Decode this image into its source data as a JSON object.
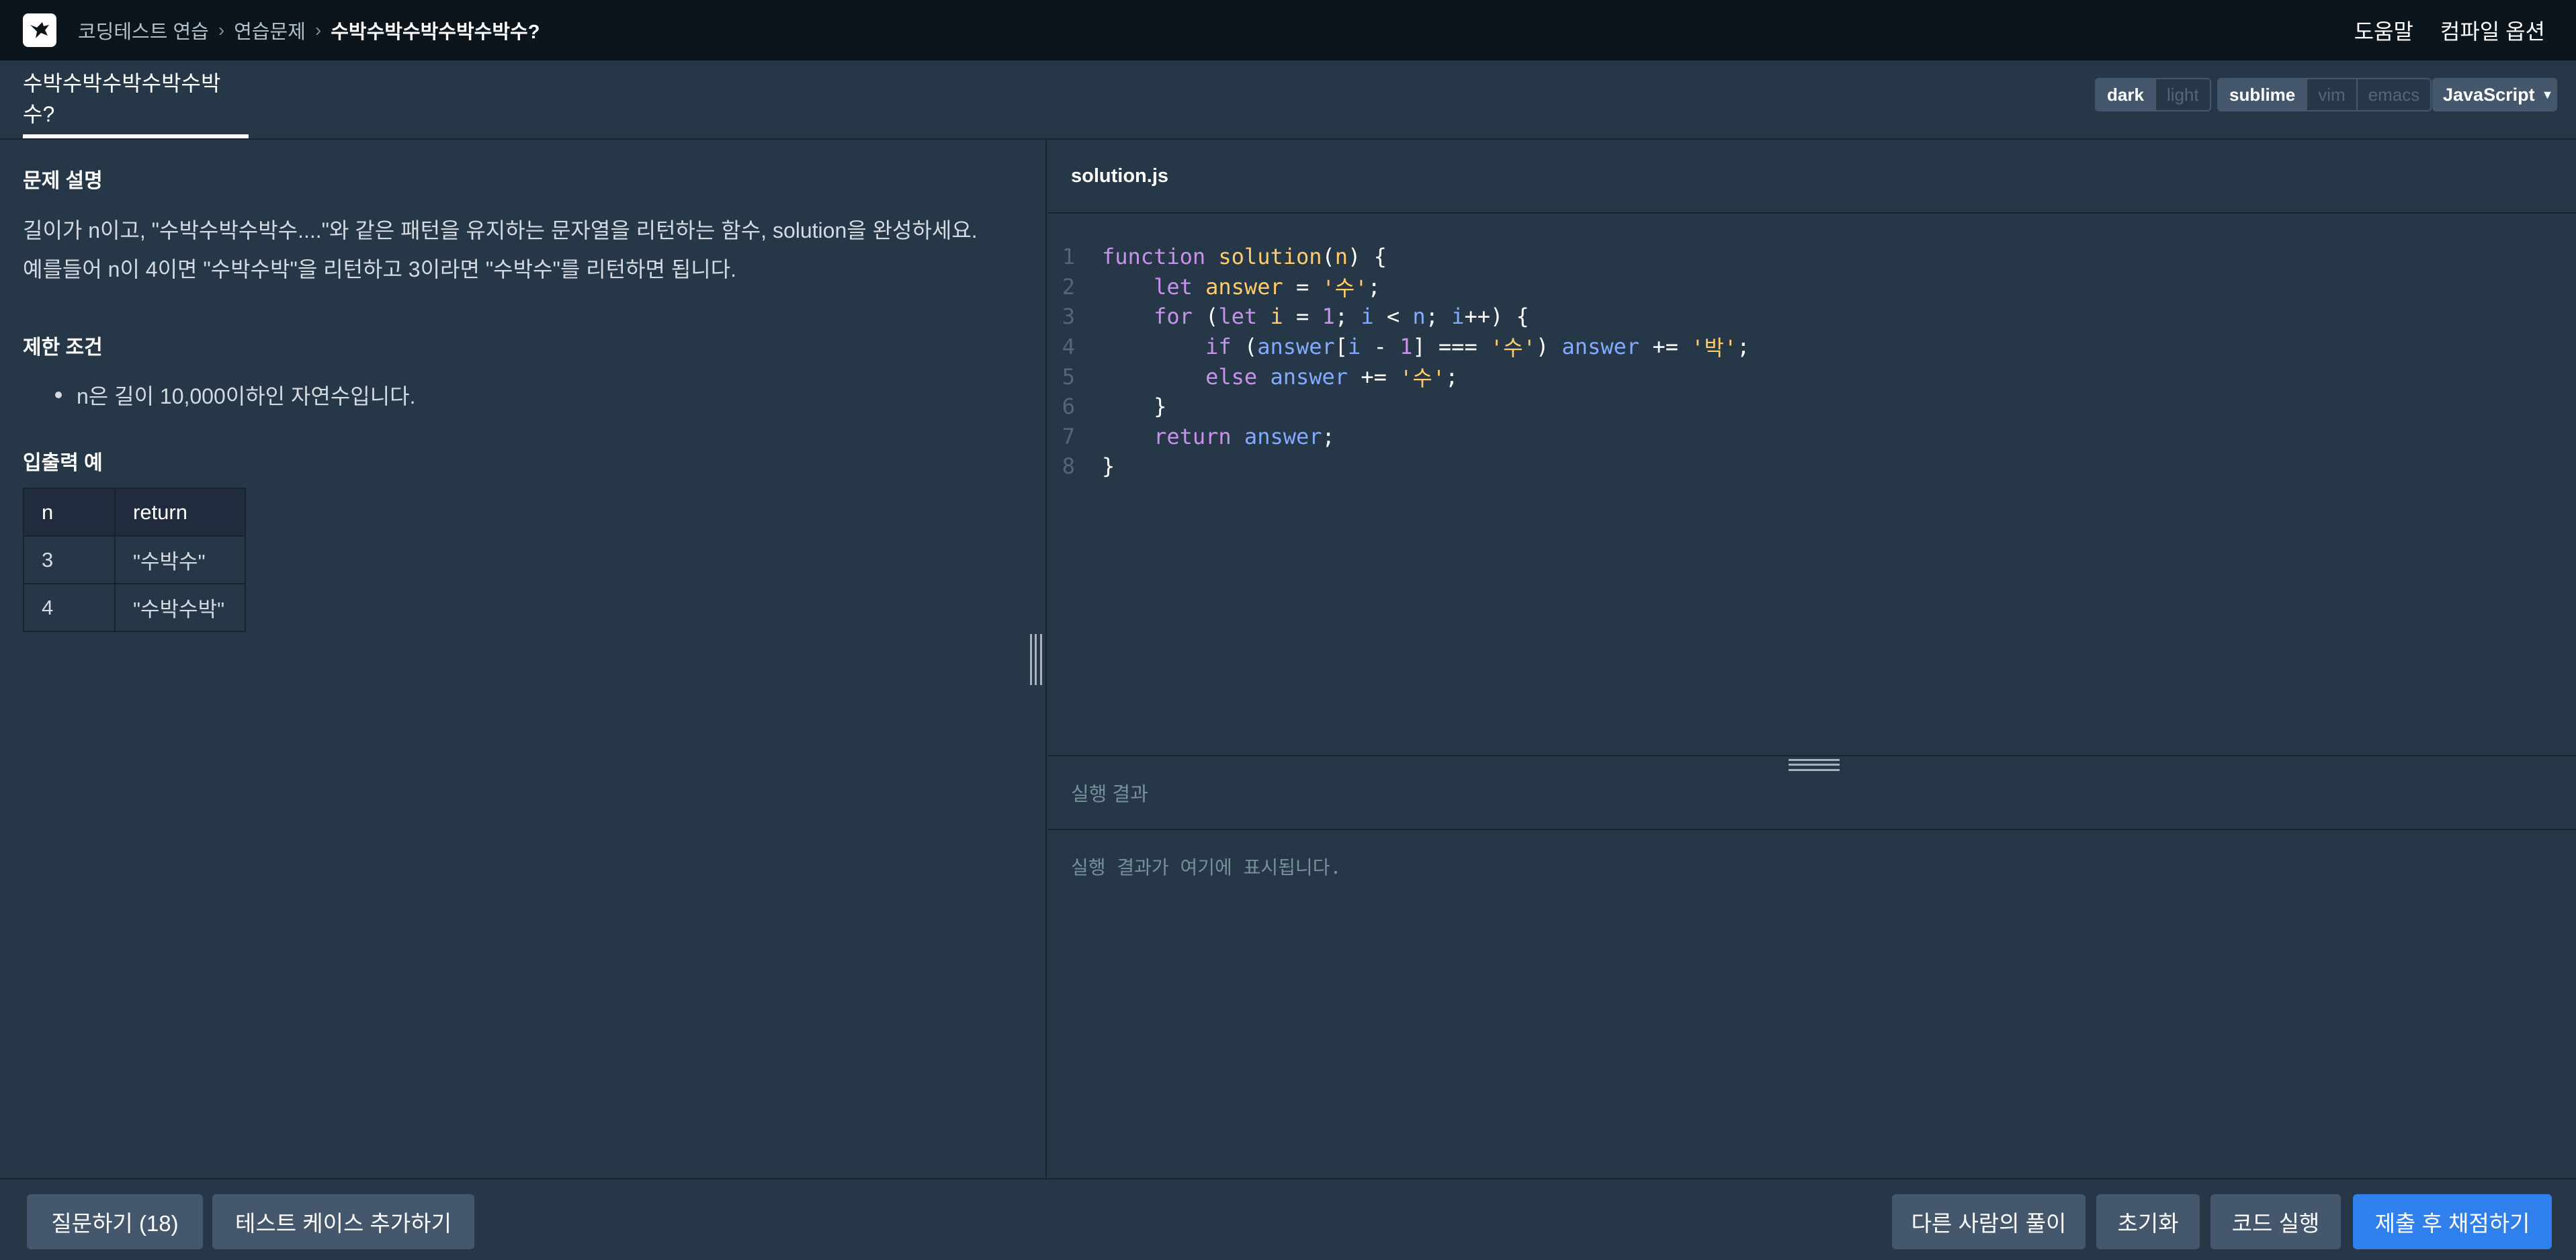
{
  "topbar": {
    "breadcrumbs": [
      "코딩테스트 연습",
      "연습문제",
      "수박수박수박수박수박수?"
    ],
    "help_label": "도움말",
    "compile_options_label": "컴파일 옵션"
  },
  "tabbar": {
    "title": "수박수박수박수박수박수?",
    "theme_options": [
      "dark",
      "light"
    ],
    "theme_selected": "dark",
    "keymap_options": [
      "sublime",
      "vim",
      "emacs"
    ],
    "keymap_selected": "sublime",
    "language": "JavaScript"
  },
  "problem": {
    "description_heading": "문제 설명",
    "description_lines": [
      "길이가 n이고, \"수박수박수박수....\"와 같은 패턴을 유지하는 문자열을 리턴하는 함수, solution을 완성하세요.",
      "예를들어 n이 4이면 \"수박수박\"을 리턴하고 3이라면 \"수박수\"를 리턴하면 됩니다."
    ],
    "constraints_heading": "제한 조건",
    "constraints": [
      "n은 길이 10,000이하인 자연수입니다."
    ],
    "examples_heading": "입출력 예",
    "table": {
      "headers": [
        "n",
        "return"
      ],
      "rows": [
        [
          "3",
          "\"수박수\""
        ],
        [
          "4",
          "\"수박수박\""
        ]
      ]
    }
  },
  "editor": {
    "filename": "solution.js",
    "line_numbers": [
      "1",
      "2",
      "3",
      "4",
      "5",
      "6",
      "7",
      "8"
    ]
  },
  "result": {
    "heading": "실행 결과",
    "placeholder": "실행 결과가 여기에 표시됩니다."
  },
  "bottombar": {
    "question_label": "질문하기 (18)",
    "add_testcase_label": "테스트 케이스 추가하기",
    "others_solution_label": "다른 사람의 풀이",
    "reset_label": "초기화",
    "run_label": "코드 실행",
    "submit_label": "제출 후 채점하기"
  },
  "colors": {
    "background": "#263747",
    "topbar": "#0c151c",
    "primary_button": "#2f80ed",
    "secondary_button": "#44576c"
  }
}
